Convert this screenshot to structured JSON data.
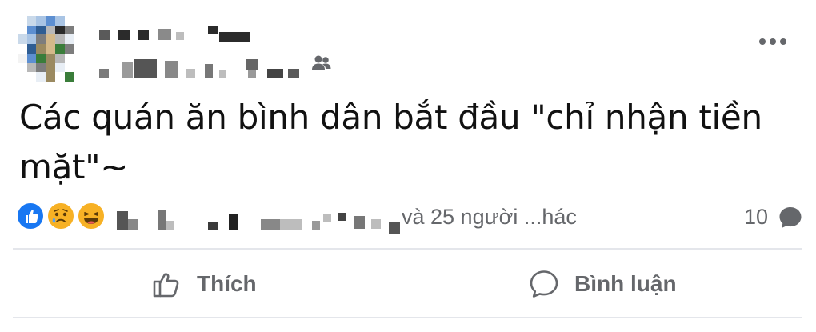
{
  "post": {
    "text": "Các quán ăn bình dân bắt đầu \"chỉ nhận tiền mặt\"~",
    "audience_icon": "friends-icon",
    "more_icon": "ellipsis-icon"
  },
  "reactions": {
    "icons": [
      "like-icon",
      "sad-icon",
      "haha-icon"
    ],
    "suffix": "và 25 người ...hác",
    "comment_count": "10",
    "colors": {
      "like": "#1877f2",
      "emoji": "#f7b125",
      "muted": "#65676b"
    }
  },
  "actions": {
    "like_label": "Thích",
    "comment_label": "Bình luận"
  }
}
